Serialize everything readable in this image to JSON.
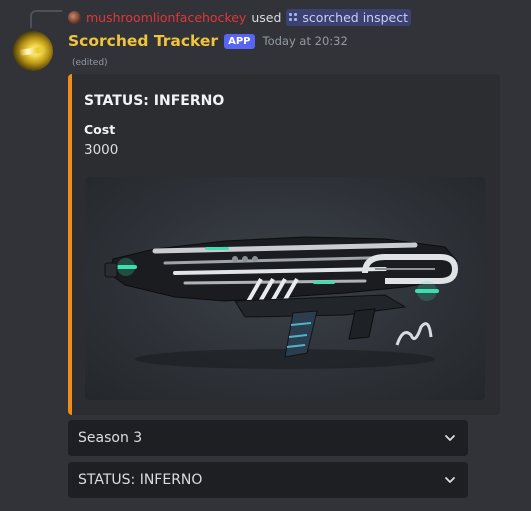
{
  "command": {
    "username": "mushroomlionfacehockey",
    "used_text": "used",
    "command_name": "scorched inspect"
  },
  "message": {
    "author": "Scorched Tracker",
    "app_tag": "APP",
    "timestamp": "Today at 20:32",
    "edited": "(edited)"
  },
  "embed": {
    "accent_color": "#f28c18",
    "title": "STATUS: INFERNO",
    "fields": [
      {
        "name": "Cost",
        "value": "3000"
      }
    ],
    "image_icon": "weapon-skin-image"
  },
  "selects": [
    {
      "label": "Season 3"
    },
    {
      "label": "STATUS: INFERNO"
    }
  ],
  "colors": {
    "background": "#313338",
    "embed_bg": "#2b2d31",
    "author": "#f0c43c",
    "app_badge": "#5865f2",
    "username": "#e0363a"
  }
}
